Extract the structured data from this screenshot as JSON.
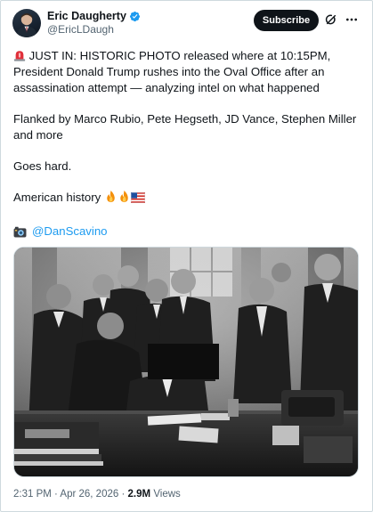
{
  "author": {
    "display_name": "Eric Daugherty",
    "handle": "@EricLDaugh",
    "verified": true,
    "verified_color": "#1d9bf0"
  },
  "header": {
    "subscribe_label": "Subscribe",
    "icons": [
      "grok-icon",
      "more-icon"
    ]
  },
  "tweet": {
    "line1": "JUST IN: HISTORIC PHOTO released where at 10:15PM, President Donald Trump rushes into the Oval Office after an assassination attempt — analyzing intel on what happened",
    "line2": "Flanked by Marco Rubio, Pete Hegseth, JD Vance, Stephen Miller and more",
    "line3": "Goes hard.",
    "line4": "American history",
    "credit_mention": "@DanScavino",
    "emojis": [
      "rotating-light-emoji",
      "fire-emoji",
      "fire-emoji",
      "us-flag-emoji",
      "camera-emoji"
    ]
  },
  "media": {
    "type": "photo",
    "description_icon": "photo"
  },
  "footer": {
    "timestamp": "2:31 PM · Apr 26, 2026",
    "separator": "·",
    "views_count": "2.9M",
    "views_label": "Views"
  },
  "colors": {
    "link": "#1d9bf0",
    "secondary_text": "#536471",
    "primary_text": "#0f1419",
    "button_bg": "#0f1419",
    "border": "#cfd9de"
  }
}
